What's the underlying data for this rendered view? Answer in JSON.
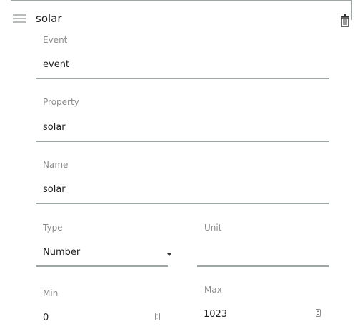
{
  "card": {
    "title": "solar"
  },
  "fields": {
    "event": {
      "label": "Event",
      "value": "event"
    },
    "property": {
      "label": "Property",
      "value": "solar"
    },
    "name": {
      "label": "Name",
      "value": "solar"
    },
    "type": {
      "label": "Type",
      "value": "Number"
    },
    "unit": {
      "label": "Unit",
      "value": ""
    },
    "min": {
      "label": "Min",
      "value": "0"
    },
    "max": {
      "label": "Max",
      "value": "1023"
    }
  },
  "icons": {
    "drag": "menu-icon",
    "delete": "trash-icon",
    "dropdown": "caret-down-icon",
    "stepper": "stepper-icon"
  },
  "colors": {
    "underline": "#9ea7a3",
    "label": "#8b8b8b",
    "text": "#1f1f1f"
  }
}
